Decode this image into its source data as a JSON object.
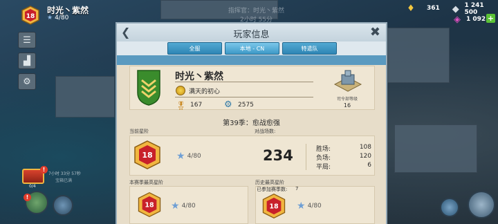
{
  "player": {
    "name": "时光丶紫然",
    "rank": "18",
    "stars": "4/80"
  },
  "resources": {
    "gold": "361",
    "wood": "1 241 500",
    "diamonds": "1 092"
  },
  "banner": {
    "line1": "指挥官：时光丶紫然",
    "line2": "2小时 55分"
  },
  "chest": {
    "count": "0/4",
    "timer": "7小时 33分 57秒",
    "sub": "宝箱已满"
  },
  "modal": {
    "title": "玩家信息",
    "tabs": [
      {
        "label": "全服"
      },
      {
        "label": "本地 - CN"
      },
      {
        "label": "特遣队"
      }
    ],
    "profile": {
      "name": "时光丶紫然",
      "guild": "满天的初心",
      "medals": "167",
      "victory_points": "2575",
      "hq_label": "司令部等级",
      "hq_level": "16"
    },
    "season_title": "第39季：愈战愈强",
    "current": {
      "label": "当前星阶",
      "rank": "18",
      "stars": "4/80"
    },
    "battles": {
      "label": "对战场数:",
      "total": "234"
    },
    "results": [
      {
        "label": "胜场:",
        "value": "108"
      },
      {
        "label": "负场:",
        "value": "120"
      },
      {
        "label": "平局:",
        "value": "6"
      }
    ],
    "season_best": {
      "label": "本赛季最高星阶",
      "rank": "18",
      "stars": "4/80"
    },
    "history_best": {
      "label": "历史最高星阶",
      "seasons_label": "已参加赛季数:",
      "seasons": "7",
      "rank": "18",
      "stars": "4/80"
    }
  },
  "colors": {
    "accent": "#2e85b4",
    "panel": "#efe6d3",
    "badge": "#c8202a",
    "shield": "#3a8c2c"
  }
}
